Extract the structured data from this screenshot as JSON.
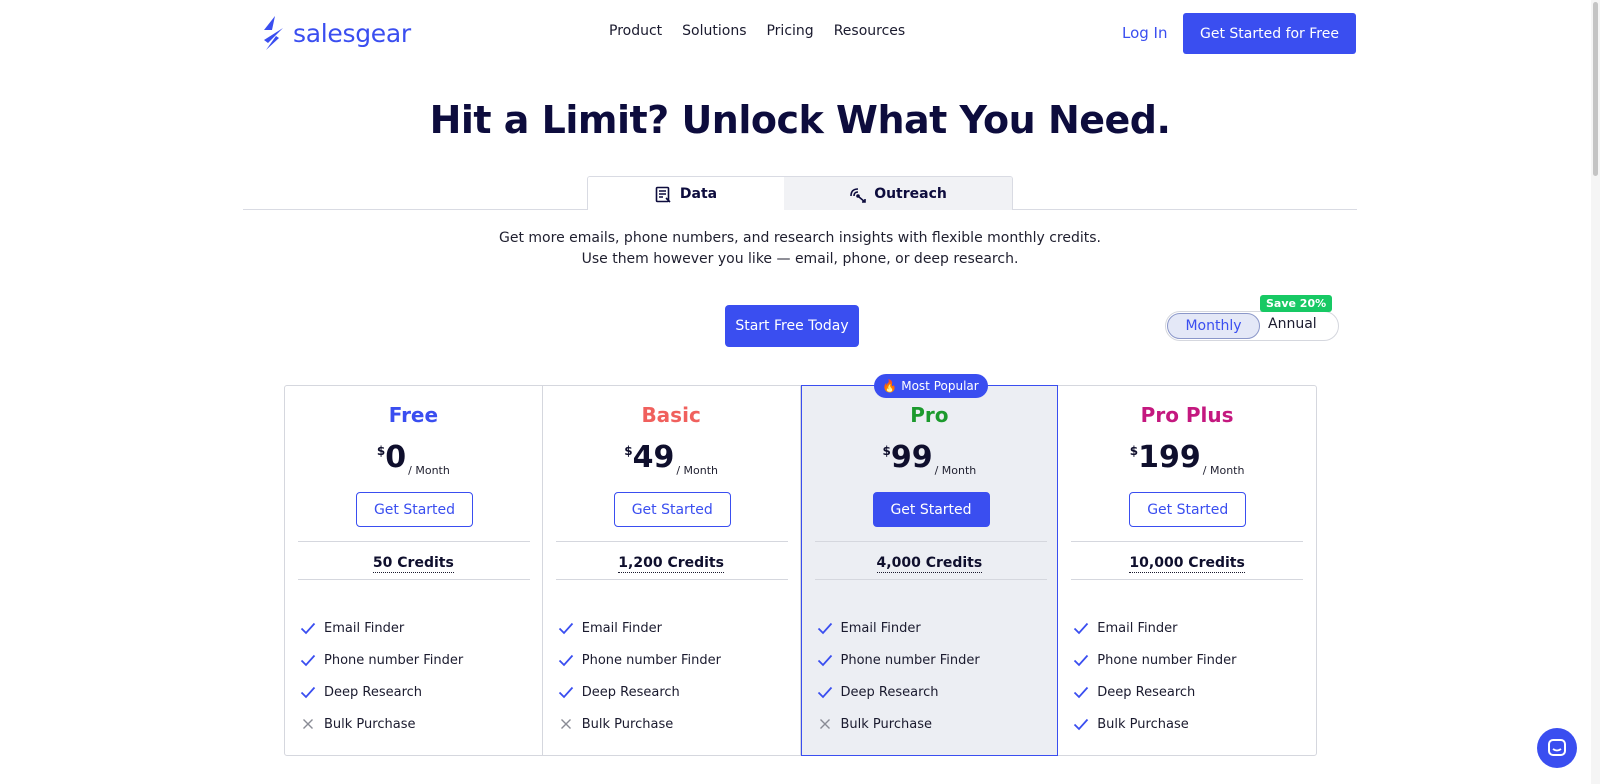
{
  "header": {
    "logo_text": "salesgear",
    "nav": [
      "Product",
      "Solutions",
      "Pricing",
      "Resources"
    ],
    "login": "Log In",
    "cta": "Get Started for Free"
  },
  "hero": {
    "title": "Hit a Limit? Unlock What You Need."
  },
  "tabs": [
    {
      "label": "Data",
      "icon": "data-list-icon"
    },
    {
      "label": "Outreach",
      "icon": "outreach-signal-icon"
    }
  ],
  "description": {
    "line1": "Get more emails, phone numbers, and research insights with flexible monthly credits.",
    "line2": "Use them however you like — email, phone, or deep research."
  },
  "start_button": "Start Free Today",
  "billing": {
    "monthly": "Monthly",
    "annual": "Annual",
    "save_badge": "Save 20%",
    "selected": "Monthly"
  },
  "popular_badge": "Most Popular",
  "plans": [
    {
      "name": "Free",
      "color": "#3a4ef0",
      "currency": "$",
      "price": "0",
      "period": "/ Month",
      "button": "Get Started",
      "credits": "50 Credits",
      "features": [
        {
          "label": "Email Finder",
          "included": true
        },
        {
          "label": "Phone number Finder",
          "included": true
        },
        {
          "label": "Deep Research",
          "included": true
        },
        {
          "label": "Bulk Purchase",
          "included": false
        }
      ]
    },
    {
      "name": "Basic",
      "color": "#f0605d",
      "currency": "$",
      "price": "49",
      "period": "/ Month",
      "button": "Get Started",
      "credits": "1,200 Credits",
      "features": [
        {
          "label": "Email Finder",
          "included": true
        },
        {
          "label": "Phone number Finder",
          "included": true
        },
        {
          "label": "Deep Research",
          "included": true
        },
        {
          "label": "Bulk Purchase",
          "included": false
        }
      ]
    },
    {
      "name": "Pro",
      "color": "#1c9a2d",
      "currency": "$",
      "price": "99",
      "period": "/ Month",
      "button": "Get Started",
      "credits": "4,000 Credits",
      "features": [
        {
          "label": "Email Finder",
          "included": true
        },
        {
          "label": "Phone number Finder",
          "included": true
        },
        {
          "label": "Deep Research",
          "included": true
        },
        {
          "label": "Bulk Purchase",
          "included": false
        }
      ]
    },
    {
      "name": "Pro Plus",
      "color": "#c4187f",
      "currency": "$",
      "price": "199",
      "period": "/ Month",
      "button": "Get Started",
      "credits": "10,000 Credits",
      "features": [
        {
          "label": "Email Finder",
          "included": true
        },
        {
          "label": "Phone number Finder",
          "included": true
        },
        {
          "label": "Deep Research",
          "included": true
        },
        {
          "label": "Bulk Purchase",
          "included": true
        }
      ]
    }
  ],
  "colors": {
    "accent": "#3a4ef0",
    "title": "#0d0c3d",
    "save_green": "#17c964"
  }
}
